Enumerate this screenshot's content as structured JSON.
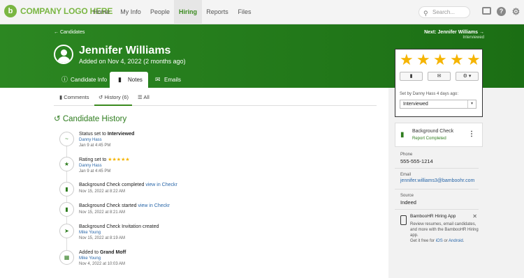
{
  "nav": {
    "logo_text": "COMPANY LOGO HERE",
    "items": [
      "Home",
      "My Info",
      "People",
      "Hiring",
      "Reports",
      "Files"
    ],
    "active": "Hiring",
    "search_placeholder": "Search..."
  },
  "header": {
    "back": "← Candidates",
    "next": "Next: Jennifer Williams →",
    "next_sub": "Interviewed",
    "name": "Jennifer Williams",
    "added": "Added on Nov 4, 2022 (2 months ago)"
  },
  "tabs": {
    "info": "Candidate Info",
    "notes": "Notes",
    "emails": "Emails"
  },
  "subtabs": {
    "comments": "Comments",
    "history": "History (6)",
    "all": "All"
  },
  "history": {
    "title": "Candidate History",
    "events": [
      {
        "text": "Status set to ",
        "bold": "Interviewed",
        "link": "Danny Hass",
        "date": "Jan 9 at 4:45 PM"
      },
      {
        "text": "Rating set to ",
        "stars": "★★★★★",
        "link": "Danny Hass",
        "date": "Jan 9 at 4:45 PM"
      },
      {
        "text": "Background Check completed",
        "inline": "view in Checkr",
        "date": "Nov 15, 2022 at 8:22 AM"
      },
      {
        "text": "Background Check started",
        "inline": "view in Checkr",
        "date": "Nov 15, 2022 at 8:21 AM"
      },
      {
        "text": "Background Check Invitation created",
        "link": "Mike Young",
        "date": "Nov 15, 2022 at 8:19 AM"
      },
      {
        "text": "Added to ",
        "bold": "Grand Moff",
        "link": "Mike Young",
        "date": "Nov 4, 2022 at 10:03 AM"
      }
    ]
  },
  "rating": {
    "stars": 5,
    "set_by": "Set by Danny Hass 4 days ago:",
    "status": "Interviewed",
    "star_color": "#f5b400"
  },
  "background_check": {
    "title": "Background Check",
    "status": "Report Completed"
  },
  "contact": {
    "phone_label": "Phone",
    "phone": "555-555-1214",
    "email_label": "Email",
    "email": "jennifer.williams3@bamboohr.com",
    "source_label": "Source",
    "source": "Indeed"
  },
  "app_promo": {
    "title": "BambooHR Hiring App",
    "desc": "Review resumes, email candidates, and more with the BambooHR Hiring app.",
    "get": "Get it free for ",
    "ios": "iOS",
    "or": " or ",
    "android": "Android",
    "end": "."
  },
  "colors": {
    "brand_green": "#2c8722",
    "link": "#2866a8"
  }
}
